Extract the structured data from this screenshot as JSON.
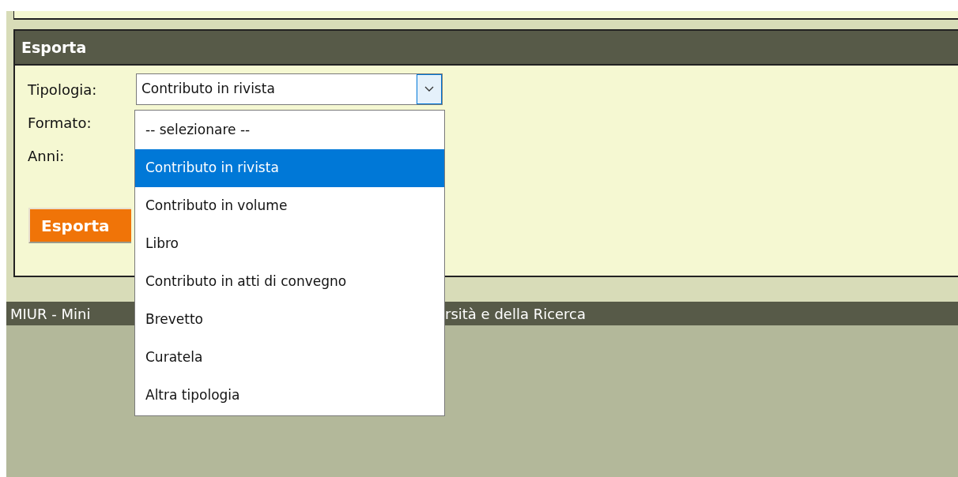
{
  "section": {
    "title": "Esporta"
  },
  "fields": [
    {
      "label": "Tipologia:",
      "kind": "select",
      "value": "Contributo in rivista"
    },
    {
      "label": "Formato:",
      "kind": "other"
    },
    {
      "label": "Anni:",
      "kind": "other"
    }
  ],
  "export_button": "Esporta",
  "dropdown": {
    "options": [
      {
        "label": "-- selezionare --",
        "selected": false
      },
      {
        "label": "Contributo in rivista",
        "selected": true
      },
      {
        "label": "Contributo in volume",
        "selected": false
      },
      {
        "label": "Libro",
        "selected": false
      },
      {
        "label": "Contributo in atti di convegno",
        "selected": false
      },
      {
        "label": "Brevetto",
        "selected": false
      },
      {
        "label": "Curatela",
        "selected": false
      },
      {
        "label": "Altra tipologia",
        "selected": false
      }
    ]
  },
  "footer": {
    "text_before": "MIUR - Mini",
    "text_after": "rsità e della Ricerca"
  }
}
